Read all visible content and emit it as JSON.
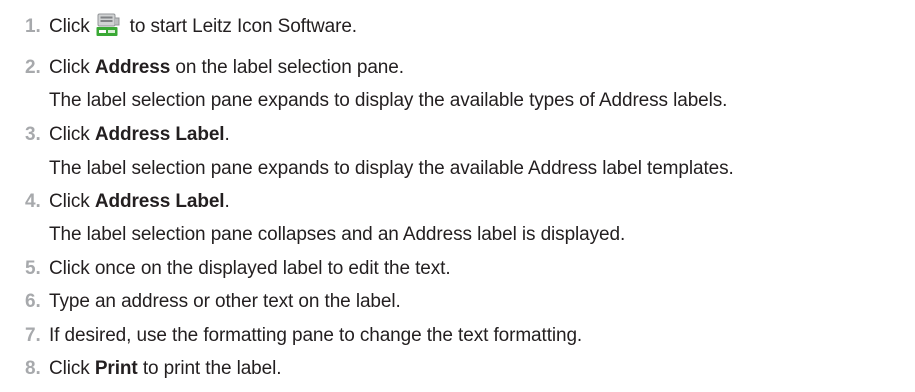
{
  "steps": [
    {
      "number": "1.",
      "before": "Click",
      "icon": "leitz-icon-printer-icon",
      "after": "to start Leitz Icon Software."
    },
    {
      "number": "2.",
      "before": "Click",
      "bold": "Address",
      "after": "on the label selection pane.",
      "note": "The label selection pane expands to display the available types of Address labels."
    },
    {
      "number": "3.",
      "before": "Click",
      "bold": "Address Label",
      "after": ".",
      "note": "The label selection pane expands to display the available Address label templates."
    },
    {
      "number": "4.",
      "before": "Click",
      "bold": "Address Label",
      "after": ".",
      "note": "The label selection pane collapses and an Address label is displayed."
    },
    {
      "number": "5.",
      "text": "Click once on the displayed label to edit the text."
    },
    {
      "number": "6.",
      "text": "Type an address or other text on the label."
    },
    {
      "number": "7.",
      "text": "If desired, use the formatting pane to change the text formatting."
    },
    {
      "number": "8.",
      "before": "Click",
      "bold": "Print",
      "after": "to print the label."
    }
  ],
  "colors": {
    "step_number": "#a7a9ac",
    "text": "#231f20",
    "icon_body": "#bcbec0",
    "icon_accent": "#3aa935"
  }
}
